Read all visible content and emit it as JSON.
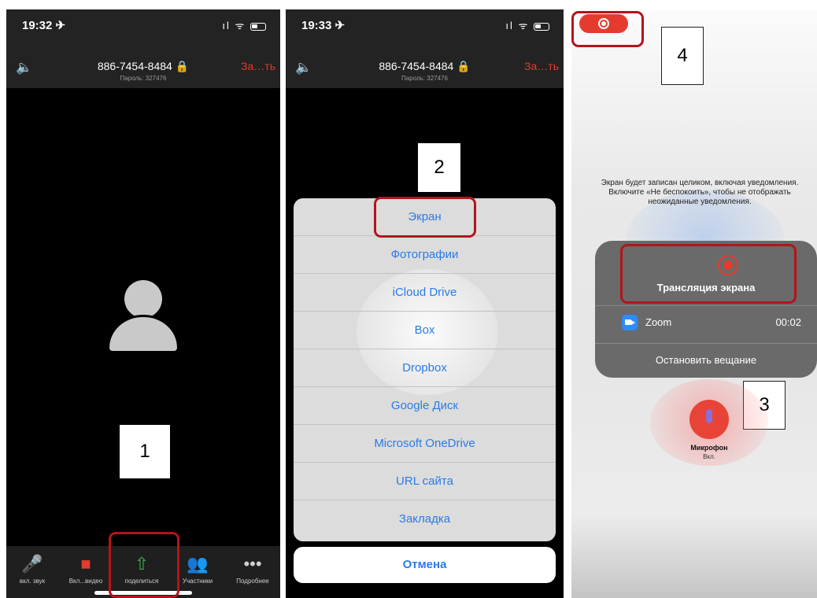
{
  "panel1": {
    "status": {
      "time": "19:32 ✈",
      "icons": "ıl ᯤ"
    },
    "header": {
      "speaker_icon": "speaker-icon",
      "meeting_id": "886-7454-8484 🔒",
      "password": "Пароль: 327476",
      "end_label": "За…ть"
    },
    "step_label": "1",
    "toolbar": [
      {
        "icon": "mic-muted-icon",
        "glyph": "🎤",
        "label": "вкл. звук"
      },
      {
        "icon": "video-off-icon",
        "glyph": "■",
        "label": "Вкл...видео"
      },
      {
        "icon": "share-icon",
        "glyph": "⇧",
        "label": "поделиться"
      },
      {
        "icon": "participants-icon",
        "glyph": "👥",
        "label": "Участники"
      },
      {
        "icon": "more-icon",
        "glyph": "•••",
        "label": "Подробнее"
      }
    ],
    "colors": {
      "end": "#e03b2f",
      "share": "#39b54a",
      "highlight": "#b3141c"
    }
  },
  "panel2": {
    "status": {
      "time": "19:33 ✈",
      "icons": "ıl ᯤ"
    },
    "header": {
      "meeting_id": "886-7454-8484 🔒",
      "password": "Пароль: 327476",
      "end_label": "За…ть"
    },
    "step_label": "2",
    "share_options": [
      "Экран",
      "Фотографии",
      "iCloud Drive",
      "Box",
      "Dropbox",
      "Google Диск",
      "Microsoft OneDrive",
      "URL сайта",
      "Закладка"
    ],
    "cancel_label": "Отмена",
    "colors": {
      "link": "#2a7be8"
    }
  },
  "panel3": {
    "step_label_top": "4",
    "notice": "Экран будет записан целиком, включая уведомления. Включите «Не беспокоить», чтобы не отображать неожиданные уведомления.",
    "broadcast_title": "Трансляция экрана",
    "app_name": "Zoom",
    "elapsed": "00:02",
    "stop_label": "Остановить вещание",
    "step_label_card": "3",
    "mic_label": "Микрофон",
    "mic_state": "Вкл.",
    "colors": {
      "record": "#e53b2f",
      "zoom": "#2d8cff"
    }
  }
}
